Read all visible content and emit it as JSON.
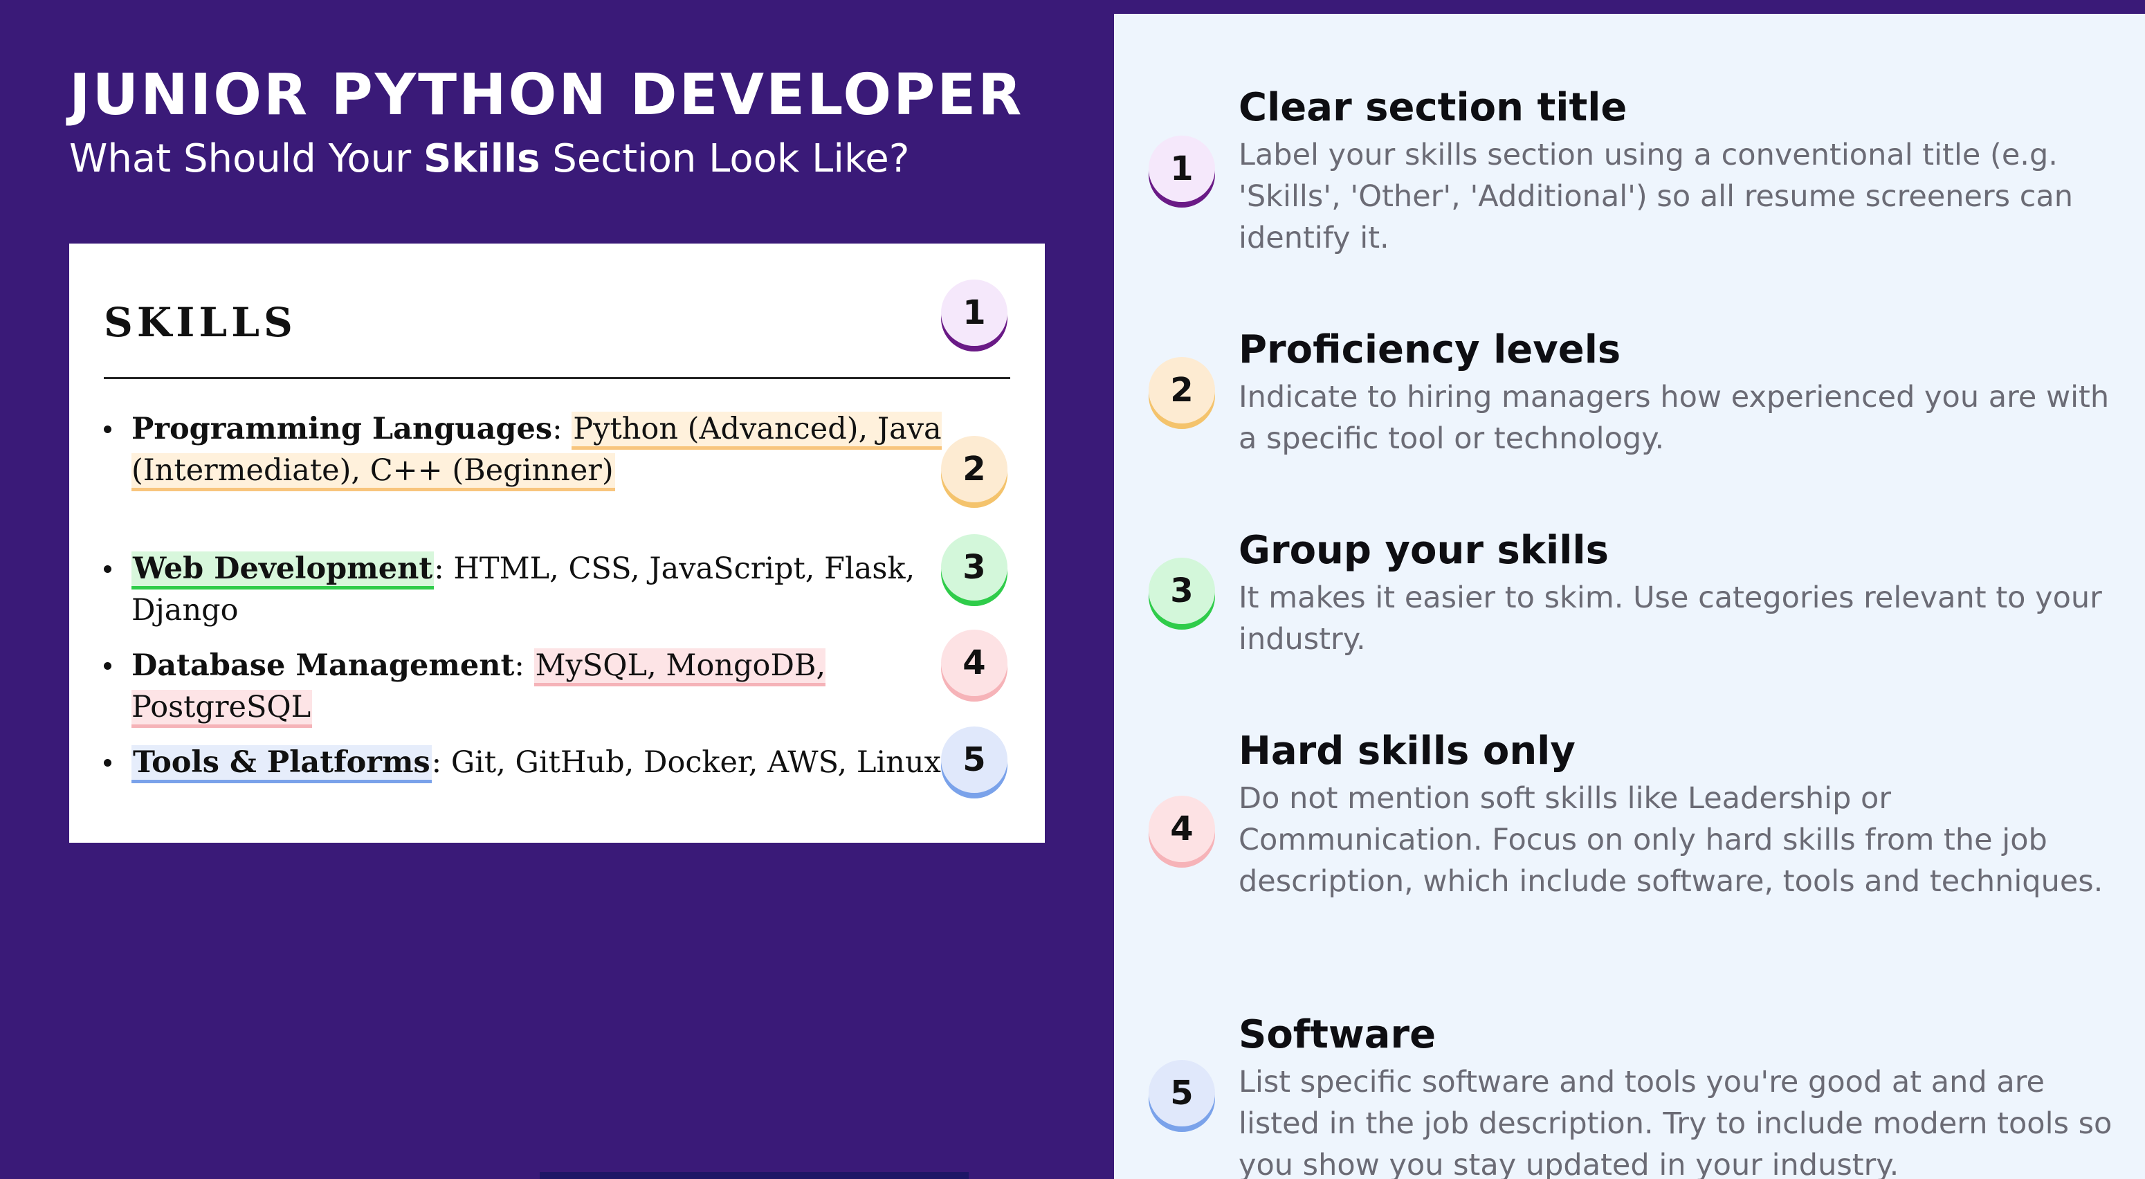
{
  "header": {
    "title": "JUNIOR PYTHON DEVELOPER",
    "subtitle_before": "What Should Your ",
    "subtitle_bold": "Skills",
    "subtitle_after": " Section Look Like?"
  },
  "resume": {
    "heading": "SKILLS",
    "items": [
      {
        "label": "Programming Languages",
        "sep": ": ",
        "value": "Python (Advanced), Java (Intermediate), C++ (Beginner)"
      },
      {
        "label": "Web Development",
        "sep": ": ",
        "value": "HTML, CSS, JavaScript, Flask, Django"
      },
      {
        "label": "Database Management",
        "sep": ": ",
        "value": "MySQL, MongoDB, PostgreSQL"
      },
      {
        "label": "Tools & Platforms",
        "sep": ": ",
        "value": "Git, GitHub, Docker, AWS, Linux"
      }
    ],
    "badges": [
      "1",
      "2",
      "3",
      "4",
      "5"
    ]
  },
  "tips": [
    {
      "number": "1",
      "title": "Clear section title",
      "description": "Label your skills section using a conventional title (e.g. 'Skills', 'Other', 'Additional') so all resume screeners can identify it."
    },
    {
      "number": "2",
      "title": "Proficiency levels",
      "description": "Indicate to hiring managers how experienced you are with a specific tool or technology."
    },
    {
      "number": "3",
      "title": "Group your skills",
      "description": "It makes it easier to skim. Use categories relevant to your industry."
    },
    {
      "number": "4",
      "title": "Hard skills only",
      "description": "Do not mention soft skills like Leadership or Communication. Focus on only hard skills from the job description, which include software, tools and techniques."
    },
    {
      "number": "5",
      "title": "Software",
      "description": "List specific software and tools you're good at and are listed in the job description. Try to include modern tools so you show you stay updated in your industry."
    }
  ],
  "colors": {
    "background": "#3a1a78",
    "panel": "#eef5fd",
    "badge_1": "#6a1a86",
    "badge_2": "#f4c36c",
    "badge_3": "#2fcc4a",
    "badge_4": "#f6b3b8",
    "badge_5": "#7aa2ea"
  }
}
